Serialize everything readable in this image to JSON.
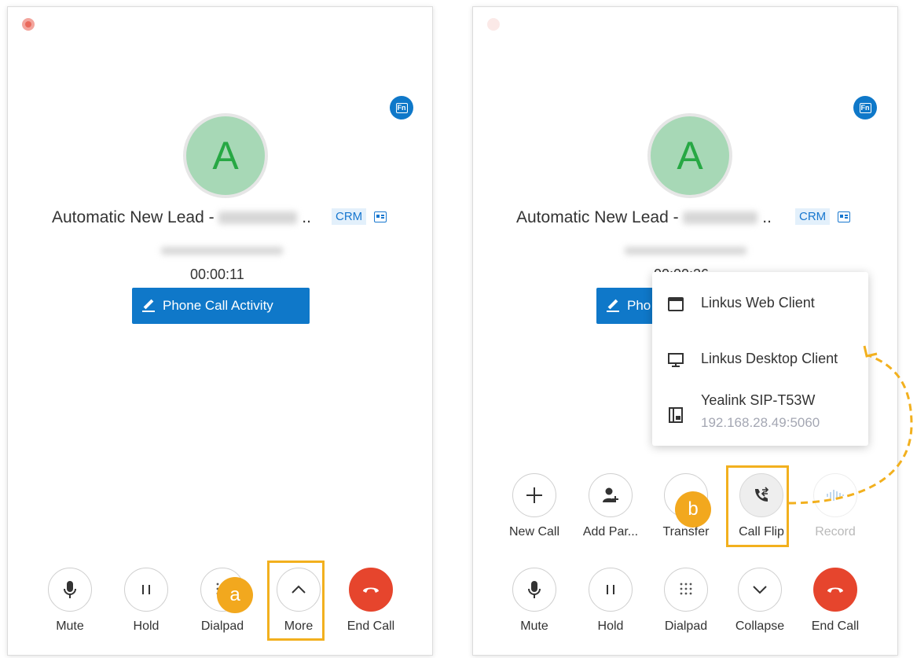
{
  "left_panel": {
    "avatar_letter": "A",
    "contact_name": "Automatic New Lead -",
    "name_ellipsis": "..",
    "crm_label": "CRM",
    "timer": "00:00:11",
    "activity_button": "Phone Call Activity",
    "controls": [
      {
        "label": "Mute",
        "icon": "microphone-icon"
      },
      {
        "label": "Hold",
        "icon": "pause-icon"
      },
      {
        "label": "Dialpad",
        "icon": "dialpad-icon"
      },
      {
        "label": "More",
        "icon": "chevron-up-icon"
      },
      {
        "label": "End Call",
        "icon": "hang-up-icon"
      }
    ],
    "step_badge": "a"
  },
  "right_panel": {
    "avatar_letter": "A",
    "contact_name": "Automatic New Lead -",
    "name_ellipsis": "..",
    "crm_label": "CRM",
    "timer_partial": "00:00:26",
    "activity_button_partial": "Pho",
    "top_controls": [
      {
        "label": "New Call",
        "icon": "plus-icon"
      },
      {
        "label": "Add Par...",
        "icon": "add-participant-icon"
      },
      {
        "label": "Transfer",
        "icon": "transfer-icon"
      },
      {
        "label": "Call Flip",
        "icon": "call-flip-icon"
      },
      {
        "label": "Record",
        "icon": "record-icon"
      }
    ],
    "bottom_controls": [
      {
        "label": "Mute",
        "icon": "microphone-icon"
      },
      {
        "label": "Hold",
        "icon": "pause-icon"
      },
      {
        "label": "Dialpad",
        "icon": "dialpad-icon"
      },
      {
        "label": "Collapse",
        "icon": "chevron-down-icon"
      },
      {
        "label": "End Call",
        "icon": "hang-up-icon"
      }
    ],
    "flip_menu": [
      {
        "label": "Linkus Web Client",
        "icon": "browser-window-icon"
      },
      {
        "label": "Linkus Desktop Client",
        "icon": "monitor-icon"
      },
      {
        "label": "Yealink SIP-T53W",
        "sublabel": "192.168.28.49:5060",
        "icon": "desk-phone-icon"
      }
    ],
    "step_badge": "b"
  },
  "colors": {
    "accent_blue": "#0f78c9",
    "end_call_red": "#e6452d",
    "highlight_orange": "#f2b01e",
    "avatar_green": "#a7d8b6"
  }
}
